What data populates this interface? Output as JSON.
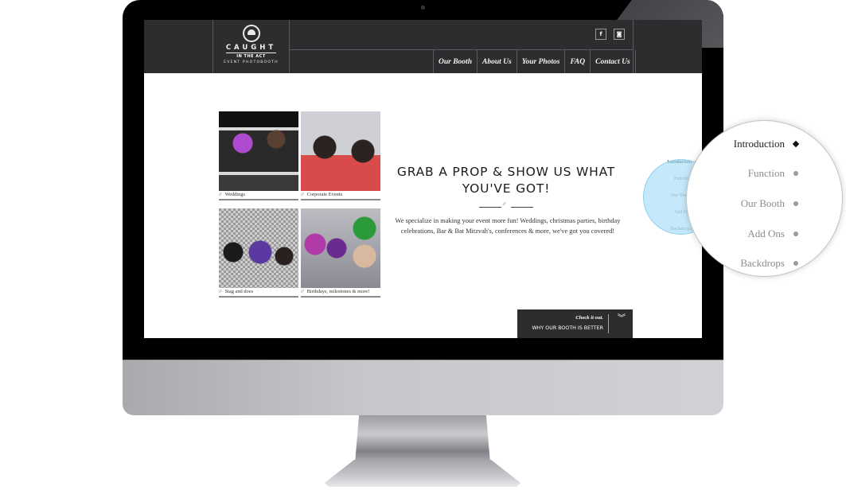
{
  "site": {
    "logo": {
      "title": "CAUGHT",
      "tagline": "IN THE ACT",
      "subtitle": "EVENT PHOTOBOOTH"
    },
    "social": [
      {
        "icon": "facebook-icon",
        "glyph": "f"
      },
      {
        "icon": "instagram-icon",
        "glyph": "◙"
      }
    ],
    "nav": [
      {
        "label": "Our Booth"
      },
      {
        "label": "About Us"
      },
      {
        "label": "Your Photos"
      },
      {
        "label": "FAQ"
      },
      {
        "label": "Contact Us"
      }
    ],
    "gallery": [
      {
        "caption": "Weddings"
      },
      {
        "caption": "Corporate Events"
      },
      {
        "caption": "Stag and does"
      },
      {
        "caption": "Birthdays, milestones & more!"
      }
    ],
    "caption_prefix": "//",
    "headline": "GRAB A PROP & SHOW US WHAT YOU'VE GOT!",
    "ornament": "//",
    "body": "We specialize in making your event more fun! Weddings, christmas parties, birthday celebrations, Bar & Bat Mitzvah's, conferences & more, we've got you covered!",
    "cta": {
      "small": "Check it out.",
      "main": "WHY OUR BOOTH IS BETTER",
      "icon_glyph": "︾"
    },
    "section_nav": [
      {
        "label": "Introduction",
        "active": true
      },
      {
        "label": "Function",
        "active": false
      },
      {
        "label": "Our Booth",
        "active": false
      },
      {
        "label": "Add Ons",
        "active": false
      },
      {
        "label": "Backdrops",
        "active": false
      }
    ]
  },
  "colors": {
    "header_bg": "#2c2d2f",
    "highlight": "#96d7f5"
  }
}
